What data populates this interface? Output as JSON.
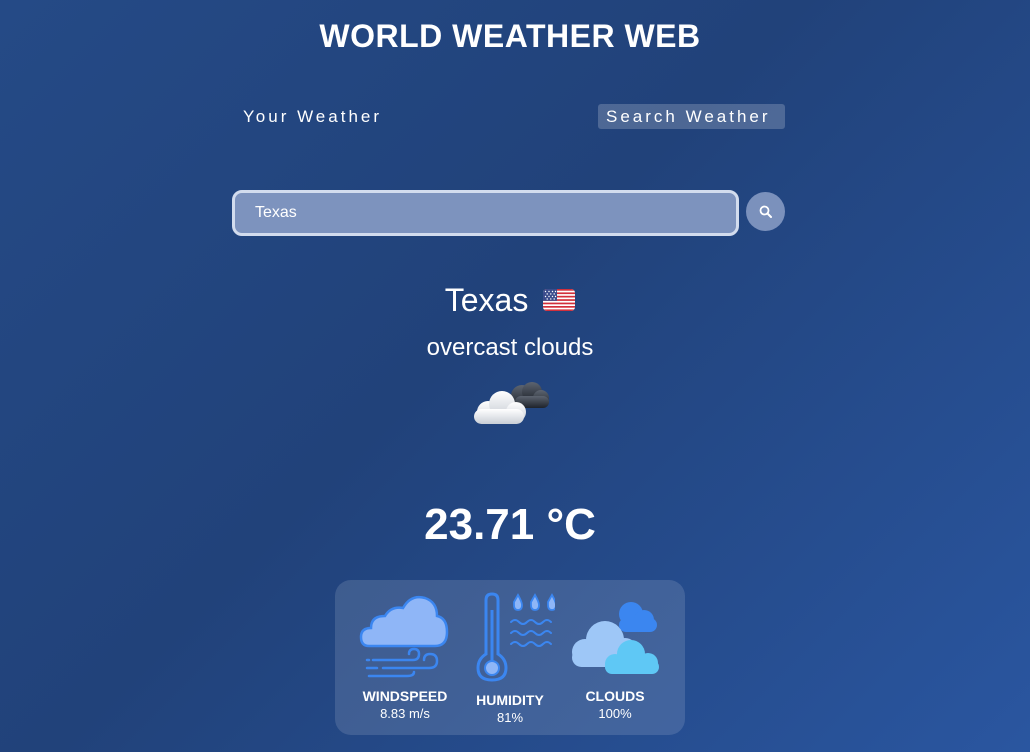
{
  "app_title": "WORLD WEATHER WEB",
  "tabs": [
    {
      "label": "Your Weather",
      "active": false
    },
    {
      "label": "Search Weather",
      "active": true
    }
  ],
  "search": {
    "value": "Texas",
    "button_icon": "search-icon"
  },
  "location": {
    "city": "Texas",
    "flag_icon": "us-flag-icon"
  },
  "weather": {
    "description": "overcast clouds",
    "icon": "overcast-clouds-icon",
    "temperature": "23.71 °C"
  },
  "stats": [
    {
      "label": "WINDSPEED",
      "value": "8.83 m/s",
      "icon": "windy-cloud-icon"
    },
    {
      "label": "HUMIDITY",
      "value": "81%",
      "icon": "thermometer-humidity-icon"
    },
    {
      "label": "CLOUDS",
      "value": "100%",
      "icon": "clouds-icon"
    }
  ],
  "colors": {
    "background": "#244985",
    "accent_blue": "#3b86f0",
    "light_blue": "#5fc8f5"
  }
}
